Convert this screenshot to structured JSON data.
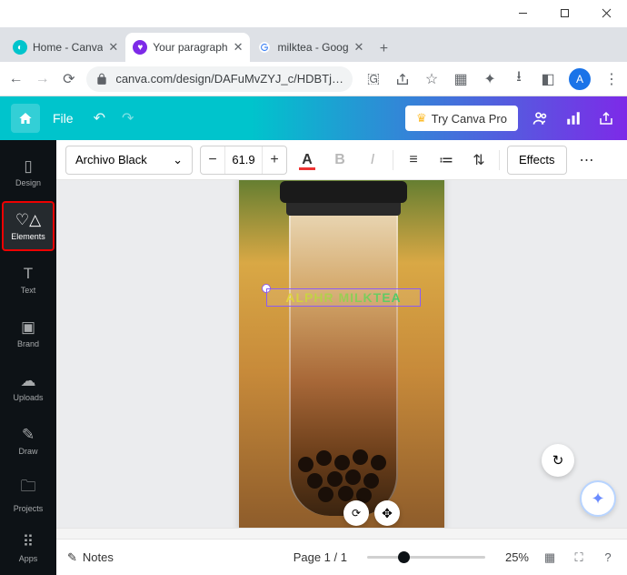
{
  "window": {
    "minimize": "—",
    "maximize": "□",
    "close": "✕"
  },
  "tabs": [
    {
      "title": "Home - Canva",
      "active": false
    },
    {
      "title": "Your paragraph",
      "active": true
    },
    {
      "title": "milktea - Goog",
      "active": false
    }
  ],
  "address": {
    "back": "←",
    "forward": "→",
    "reload": "↻",
    "url": "canva.com/design/DAFuMvZYJ_c/HDBTj…",
    "avatar_letter": "A"
  },
  "canva_top": {
    "file": "File",
    "try_pro": "Try Canva Pro"
  },
  "sidebar": {
    "items": [
      {
        "label": "Design"
      },
      {
        "label": "Elements"
      },
      {
        "label": "Text"
      },
      {
        "label": "Brand"
      },
      {
        "label": "Uploads"
      },
      {
        "label": "Draw"
      },
      {
        "label": "Projects"
      },
      {
        "label": "Apps"
      }
    ]
  },
  "toolbar": {
    "font": "Archivo Black",
    "size": "61.9",
    "effects_label": "Effects"
  },
  "canvas": {
    "text_content": "ALPHR MILKTEA"
  },
  "bottom": {
    "notes": "Notes",
    "page_indicator": "Page 1 / 1",
    "zoom": "25%"
  }
}
